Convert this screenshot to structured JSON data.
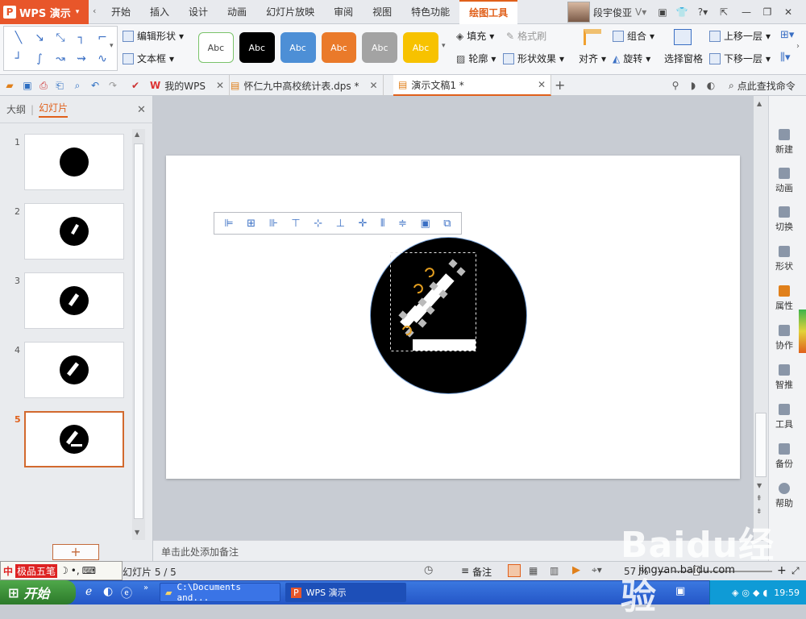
{
  "app": {
    "logo_label": "WPS 演示"
  },
  "menu_tabs": [
    "开始",
    "插入",
    "设计",
    "动画",
    "幻灯片放映",
    "审阅",
    "视图",
    "特色功能",
    "绘图工具"
  ],
  "user": {
    "name": "段宇俊亚"
  },
  "ribbon": {
    "edit_shape": "编辑形状",
    "text_box": "文本框",
    "style_label": "Abc",
    "fill": "填充",
    "format_brush": "格式刷",
    "outline": "轮廓",
    "shape_effect": "形状效果",
    "align": "对齐",
    "group": "组合",
    "rotate": "旋转",
    "selection_pane": "选择窗格",
    "bring_forward": "上移一层",
    "send_backward": "下移一层"
  },
  "colors": {
    "accent": "#e0601b",
    "fill_black": "#000000",
    "blue": "#4d8fd6",
    "orange": "#ea7a2a",
    "gray": "#a3a3a3",
    "yellow": "#f7c200"
  },
  "doc_tabs": [
    "我的WPS",
    "怀仁九中高校统计表.dps *",
    "演示文稿1 *"
  ],
  "search": {
    "placeholder": "点此查找命令"
  },
  "panel": {
    "tab_outline": "大纲",
    "tab_slides": "幻灯片"
  },
  "slides": [
    {
      "num": "1"
    },
    {
      "num": "2"
    },
    {
      "num": "3"
    },
    {
      "num": "4"
    },
    {
      "num": "5"
    }
  ],
  "right_panel": [
    "新建",
    "动画",
    "切换",
    "形状",
    "属性",
    "协作",
    "智推",
    "工具",
    "备份",
    "帮助"
  ],
  "notes": {
    "placeholder": "单击此处添加备注"
  },
  "status": {
    "slide_info": "幻灯片 5 / 5",
    "notes_btn": "备注",
    "zoom": "57 %"
  },
  "ime": {
    "name": "极品五笔"
  },
  "taskbar": {
    "start": "开始",
    "task1": "C:\\Documents and...",
    "task2": "WPS 演示",
    "time": "19:59"
  },
  "watermark": {
    "text": "Baidu经验",
    "sub": "jingyan.baidu.com"
  }
}
